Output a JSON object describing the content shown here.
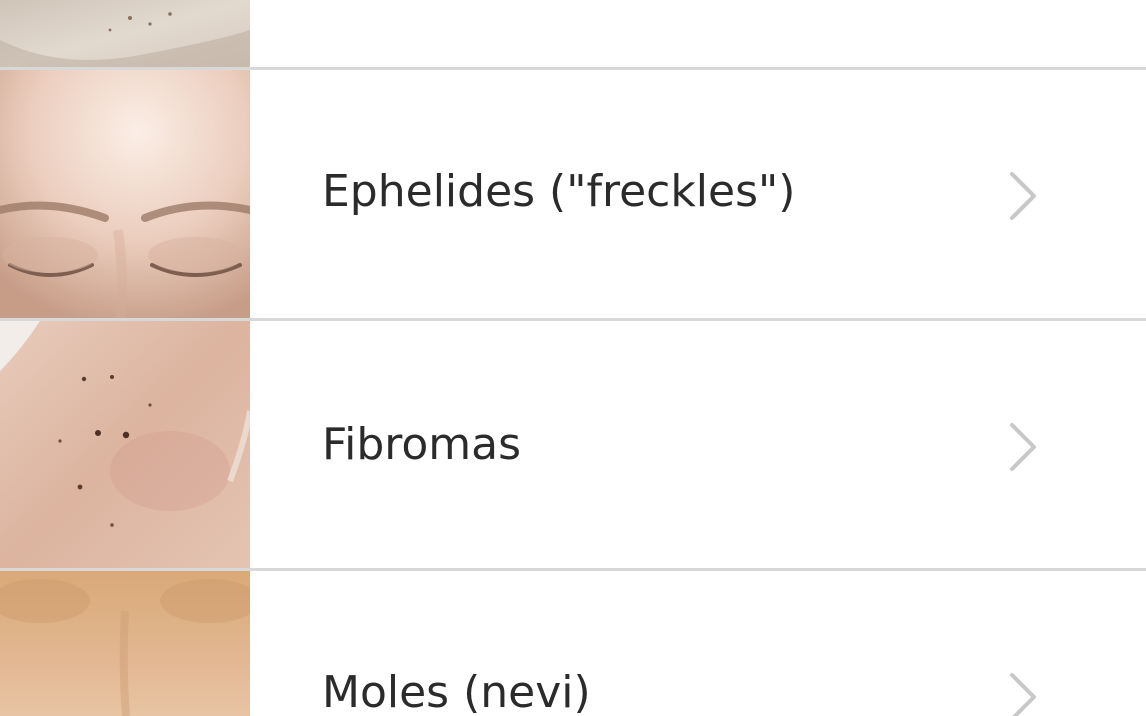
{
  "list": {
    "items": [
      {
        "label": "Ephelides (\"freckles\")",
        "thumbnail": "face-forehead-closed-eyes-photo",
        "icon": "chevron-right-icon"
      },
      {
        "label": "Fibromas",
        "thumbnail": "skin-back-with-spots-photo",
        "icon": "chevron-right-icon"
      },
      {
        "label": "Moles (nevi)",
        "thumbnail": "skin-back-tan-photo",
        "icon": "chevron-right-icon"
      }
    ]
  },
  "colors": {
    "background": "#ffffff",
    "text": "#2b2b2b",
    "divider": "#d8d8d8",
    "chevron": "#c8c8c8"
  }
}
